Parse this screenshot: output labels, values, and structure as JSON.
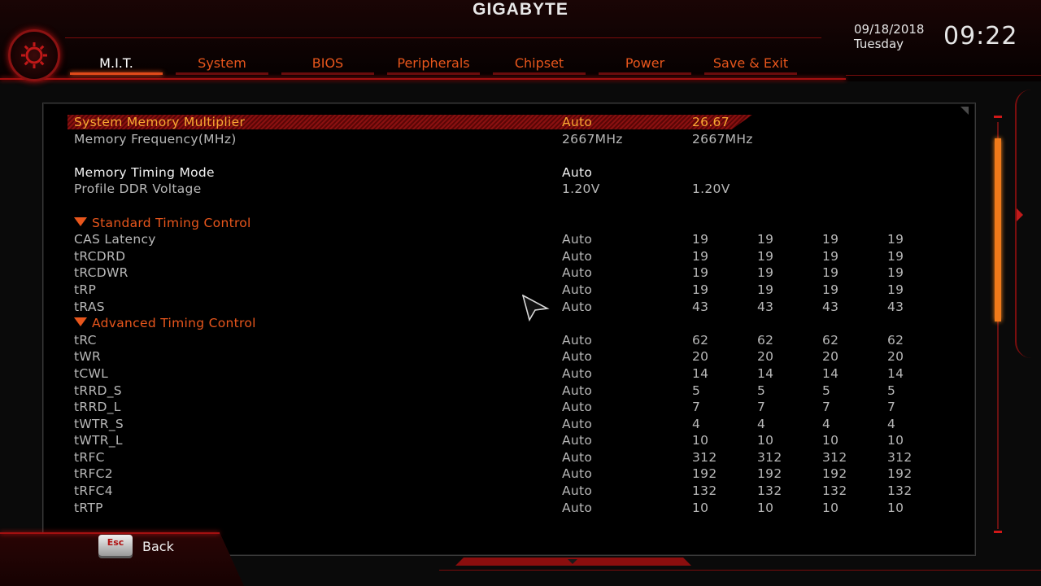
{
  "header": {
    "brand": "GIGABYTE",
    "date": "09/18/2018",
    "weekday": "Tuesday",
    "time": "09:22",
    "accent_color": "#e8561c"
  },
  "tabs": [
    {
      "label": "M.I.T.",
      "active": true
    },
    {
      "label": "System"
    },
    {
      "label": "BIOS"
    },
    {
      "label": "Peripherals"
    },
    {
      "label": "Chipset"
    },
    {
      "label": "Power"
    },
    {
      "label": "Save & Exit"
    }
  ],
  "settings": {
    "system_memory_multiplier": {
      "label": "System Memory Multiplier",
      "mode": "Auto",
      "value": "26.67"
    },
    "memory_frequency": {
      "label": "Memory Frequency(MHz)",
      "mode": "2667MHz",
      "value": "2667MHz"
    },
    "memory_timing_mode": {
      "label": "Memory Timing Mode",
      "mode": "Auto"
    },
    "profile_ddr_voltage": {
      "label": "Profile DDR Voltage",
      "mode": "1.20V",
      "value": "1.20V"
    }
  },
  "sections": {
    "standard": "Standard Timing Control",
    "advanced": "Advanced Timing Control"
  },
  "standard_timings": [
    {
      "label": "CAS Latency",
      "mode": "Auto",
      "values": [
        "19",
        "19",
        "19",
        "19"
      ]
    },
    {
      "label": "tRCDRD",
      "mode": "Auto",
      "values": [
        "19",
        "19",
        "19",
        "19"
      ]
    },
    {
      "label": "tRCDWR",
      "mode": "Auto",
      "values": [
        "19",
        "19",
        "19",
        "19"
      ]
    },
    {
      "label": "tRP",
      "mode": "Auto",
      "values": [
        "19",
        "19",
        "19",
        "19"
      ]
    },
    {
      "label": "tRAS",
      "mode": "Auto",
      "values": [
        "43",
        "43",
        "43",
        "43"
      ]
    }
  ],
  "advanced_timings": [
    {
      "label": "tRC",
      "mode": "Auto",
      "values": [
        "62",
        "62",
        "62",
        "62"
      ]
    },
    {
      "label": "tWR",
      "mode": "Auto",
      "values": [
        "20",
        "20",
        "20",
        "20"
      ]
    },
    {
      "label": "tCWL",
      "mode": "Auto",
      "values": [
        "14",
        "14",
        "14",
        "14"
      ]
    },
    {
      "label": "tRRD_S",
      "mode": "Auto",
      "values": [
        "5",
        "5",
        "5",
        "5"
      ]
    },
    {
      "label": "tRRD_L",
      "mode": "Auto",
      "values": [
        "7",
        "7",
        "7",
        "7"
      ]
    },
    {
      "label": "tWTR_S",
      "mode": "Auto",
      "values": [
        "4",
        "4",
        "4",
        "4"
      ]
    },
    {
      "label": "tWTR_L",
      "mode": "Auto",
      "values": [
        "10",
        "10",
        "10",
        "10"
      ]
    },
    {
      "label": "tRFC",
      "mode": "Auto",
      "values": [
        "312",
        "312",
        "312",
        "312"
      ]
    },
    {
      "label": "tRFC2",
      "mode": "Auto",
      "values": [
        "192",
        "192",
        "192",
        "192"
      ]
    },
    {
      "label": "tRFC4",
      "mode": "Auto",
      "values": [
        "132",
        "132",
        "132",
        "132"
      ]
    },
    {
      "label": "tRTP",
      "mode": "Auto",
      "values": [
        "10",
        "10",
        "10",
        "10"
      ]
    }
  ],
  "footer": {
    "esc_key": "Esc",
    "back_label": "Back"
  },
  "scroll": {
    "position_fraction": 0.04,
    "visible_fraction": 0.45
  },
  "icons": {
    "settings": "gear-icon",
    "cursor": "mouse-pointer-icon",
    "section_toggle": "triangle-down-icon"
  }
}
